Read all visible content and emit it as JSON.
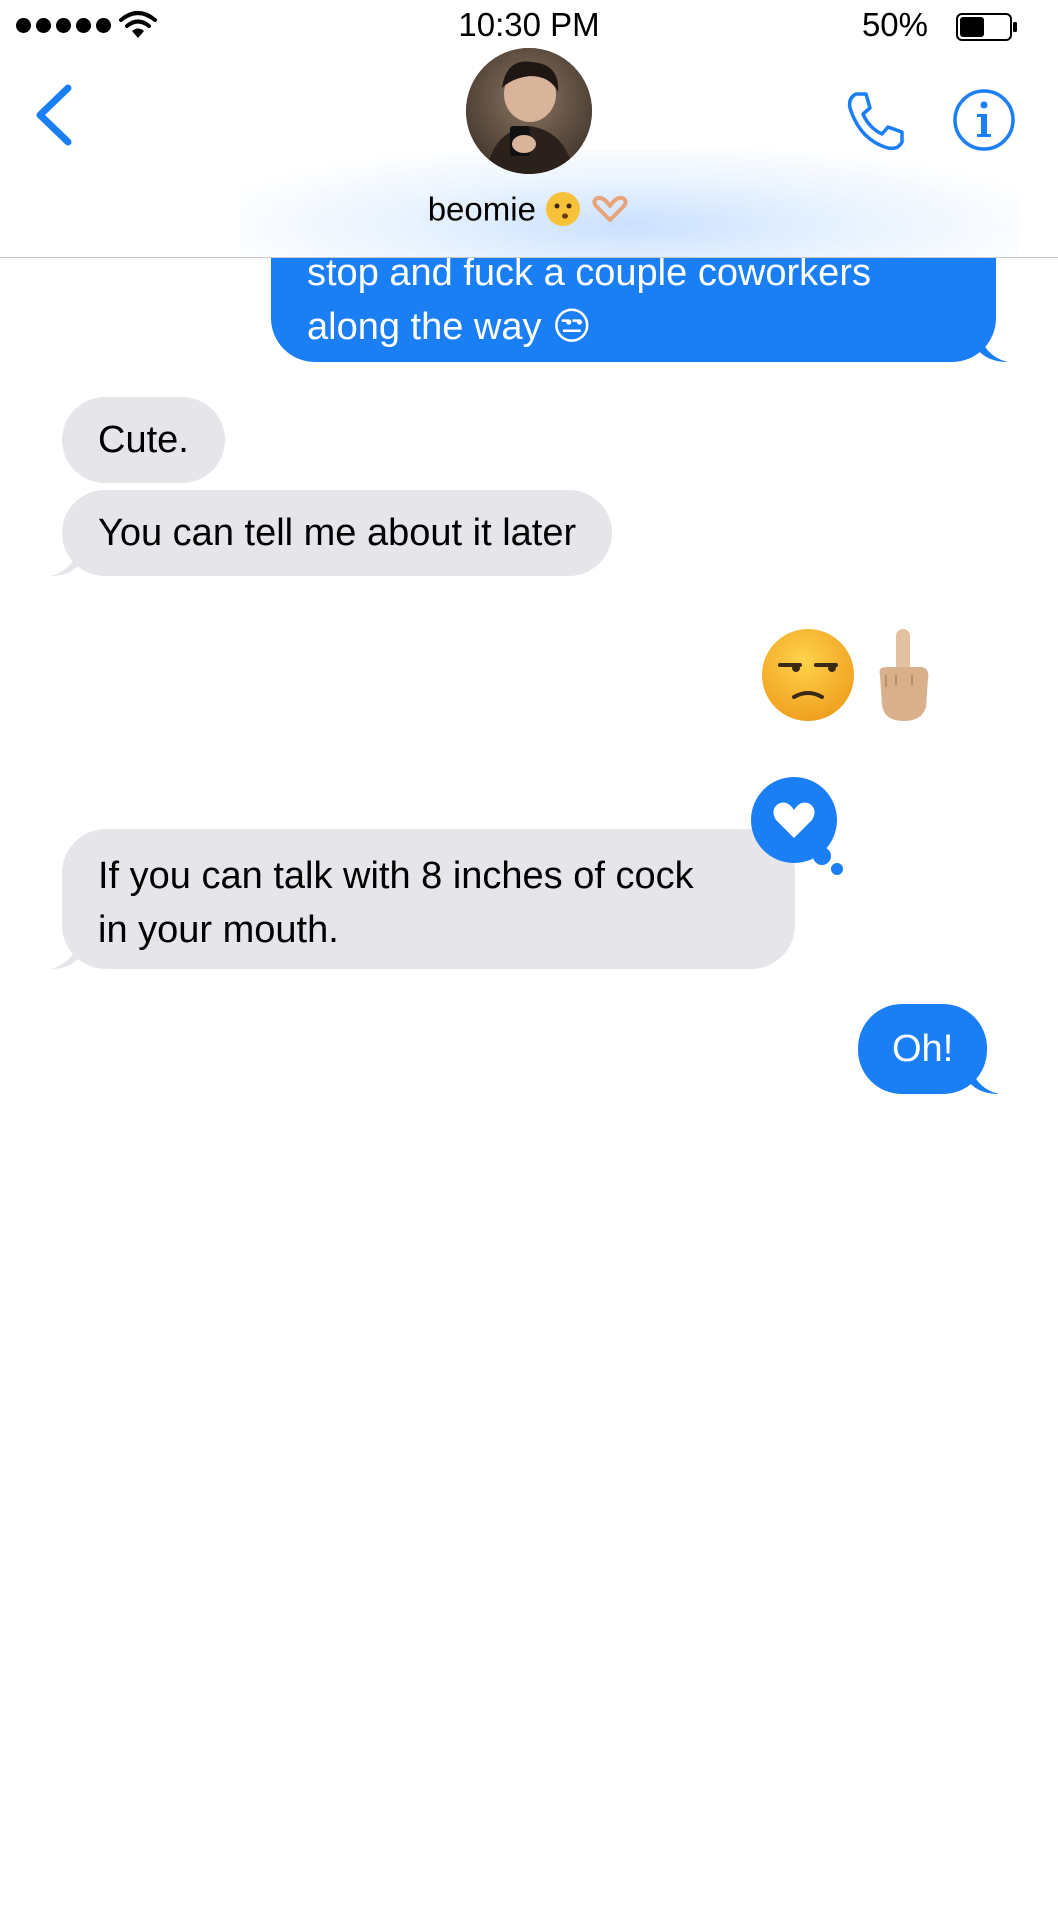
{
  "status_bar": {
    "time": "10:30 PM",
    "battery_percent": "50%",
    "battery_level": 0.5,
    "signal_bars": 5,
    "wifi_icon": "wifi-icon"
  },
  "header": {
    "contact_name": "beomie",
    "name_emojis": "😗🫶",
    "back_icon": "chevron-left-icon",
    "call_icon": "phone-icon",
    "info_icon": "info-icon"
  },
  "colors": {
    "sent_bubble": "#1a7ef5",
    "received_bubble": "#e5e5ea",
    "accent": "#1a7ef5"
  },
  "messages": [
    {
      "direction": "sent",
      "text_line1": "stop and fuck a couple coworkers",
      "text_line2": "along the way 😒"
    },
    {
      "direction": "received",
      "text": "Cute."
    },
    {
      "direction": "received",
      "text": "You can tell me about it later"
    },
    {
      "direction": "sent",
      "text": "😒 🖕🏼"
    },
    {
      "direction": "received",
      "text_line1": "If you can talk with 8 inches of cock",
      "text_line2": "in your mouth.",
      "tapback": "heart"
    },
    {
      "direction": "sent",
      "text": "Oh!"
    }
  ]
}
